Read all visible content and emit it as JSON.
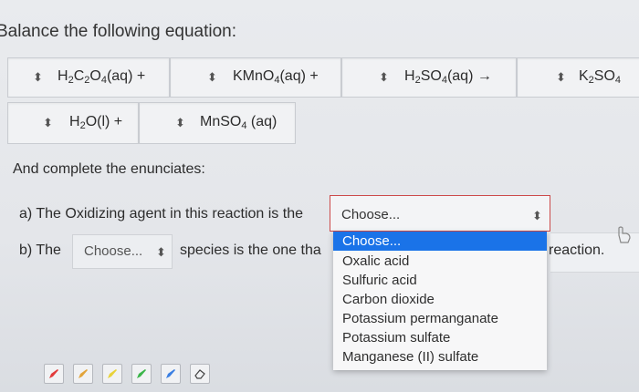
{
  "title": "Balance the following equation:",
  "equation": {
    "term1": "H₂C₂O₄(aq) +",
    "term2": "KMnO₄(aq) +",
    "term3": "H₂SO₄(aq) →",
    "term4": "K₂SO₄",
    "term5": "H₂O(l) +",
    "term6": "MnSO₄ (aq)"
  },
  "subtitle": "And complete the enunciates:",
  "question_a": "a) The Oxidizing agent in this reaction is the",
  "question_b_prefix": "b) The",
  "question_b_middle": "species is the one tha",
  "question_b_suffix": "reaction.",
  "select_a_value": "Choose...",
  "select_b_value": "Choose...",
  "dropdown": {
    "selected": "Choose...",
    "options": [
      "Oxalic acid",
      "Sulfuric acid",
      "Carbon dioxide",
      "Potassium permanganate",
      "Potassium sulfate",
      "Manganese (II) sulfate"
    ]
  },
  "stepper_glyph": "⬍",
  "colors": {
    "accent": "#1a73e8",
    "error_border": "#cc4a4a"
  },
  "toolbar_icons": [
    "pencil-icon",
    "pencil-icon",
    "pencil-icon",
    "pencil-icon",
    "pencil-icon",
    "eraser-icon"
  ]
}
